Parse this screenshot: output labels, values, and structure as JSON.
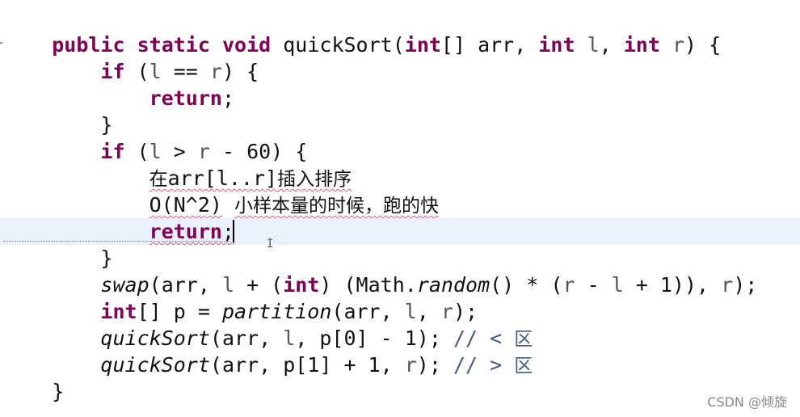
{
  "code": {
    "current_line": 8,
    "lines": [
      {
        "tokens": [
          [
            "    ",
            ""
          ],
          [
            "public",
            "kw"
          ],
          [
            " ",
            ""
          ],
          [
            "static",
            "kw"
          ],
          [
            " ",
            ""
          ],
          [
            "void",
            "kw"
          ],
          [
            " quickSort(",
            ""
          ],
          [
            "int",
            "kw"
          ],
          [
            "[] arr, ",
            ""
          ],
          [
            "int",
            "kw"
          ],
          [
            " ",
            ""
          ],
          [
            "l",
            "var"
          ],
          [
            ", ",
            ""
          ],
          [
            "int",
            "kw"
          ],
          [
            " ",
            ""
          ],
          [
            "r",
            "var"
          ],
          [
            ") {",
            ""
          ]
        ]
      },
      {
        "tokens": [
          [
            "        ",
            ""
          ],
          [
            "if",
            "kw"
          ],
          [
            " (",
            ""
          ],
          [
            "l",
            "var"
          ],
          [
            " == ",
            ""
          ],
          [
            "r",
            "var"
          ],
          [
            ") {",
            ""
          ]
        ]
      },
      {
        "tokens": [
          [
            "            ",
            ""
          ],
          [
            "return",
            "kw"
          ],
          [
            ";",
            ""
          ]
        ]
      },
      {
        "tokens": [
          [
            "        }",
            ""
          ]
        ]
      },
      {
        "tokens": [
          [
            "        ",
            ""
          ],
          [
            "if",
            "kw"
          ],
          [
            " (",
            ""
          ],
          [
            "l",
            "var"
          ],
          [
            " > ",
            ""
          ],
          [
            "r",
            "var"
          ],
          [
            " - 60) {",
            ""
          ]
        ]
      },
      {
        "tokens": [
          [
            "            ",
            ""
          ],
          [
            "在",
            "squig cjk"
          ],
          [
            "arr[l..r]",
            "squig"
          ],
          [
            "插入排序",
            "squig cjk"
          ]
        ]
      },
      {
        "tokens": [
          [
            "            ",
            ""
          ],
          [
            "O(N^2)",
            "squig"
          ],
          [
            " ",
            ""
          ],
          [
            "小样本量的时候，跑的快",
            "squig cjk"
          ]
        ]
      },
      {
        "tokens": [
          [
            "            ",
            ""
          ],
          [
            "return",
            "kw squig"
          ],
          [
            ";",
            "squig"
          ]
        ]
      },
      {
        "tokens": [
          [
            "        }",
            ""
          ]
        ]
      },
      {
        "tokens": [
          [
            "        ",
            ""
          ],
          [
            "swap",
            "it"
          ],
          [
            "(arr, ",
            ""
          ],
          [
            "l",
            "var"
          ],
          [
            " + (",
            ""
          ],
          [
            "int",
            "kw"
          ],
          [
            ") (Math.",
            ""
          ],
          [
            "random",
            "it"
          ],
          [
            "() * (",
            ""
          ],
          [
            "r",
            "var"
          ],
          [
            " - ",
            ""
          ],
          [
            "l",
            "var"
          ],
          [
            " + 1)), ",
            ""
          ],
          [
            "r",
            "var"
          ],
          [
            ");",
            ""
          ]
        ]
      },
      {
        "tokens": [
          [
            "        ",
            ""
          ],
          [
            "int",
            "kw"
          ],
          [
            "[] p = ",
            ""
          ],
          [
            "partition",
            "it"
          ],
          [
            "(arr, ",
            ""
          ],
          [
            "l",
            "var"
          ],
          [
            ", ",
            ""
          ],
          [
            "r",
            "var"
          ],
          [
            ");",
            ""
          ]
        ]
      },
      {
        "tokens": [
          [
            "        ",
            ""
          ],
          [
            "quickSort",
            "it"
          ],
          [
            "(arr, ",
            ""
          ],
          [
            "l",
            "var"
          ],
          [
            ", p[0] - 1); ",
            ""
          ],
          [
            "// < ",
            "cm"
          ],
          [
            "区",
            "cm cjk"
          ]
        ]
      },
      {
        "tokens": [
          [
            "        ",
            ""
          ],
          [
            "quickSort",
            "it"
          ],
          [
            "(arr, p[1] + 1, ",
            ""
          ],
          [
            "r",
            "var"
          ],
          [
            "); ",
            ""
          ],
          [
            "// > ",
            "cm"
          ],
          [
            "区",
            "cm cjk"
          ]
        ]
      },
      {
        "tokens": [
          [
            "    }",
            ""
          ]
        ]
      }
    ]
  },
  "watermark": "CSDN @倾旋"
}
